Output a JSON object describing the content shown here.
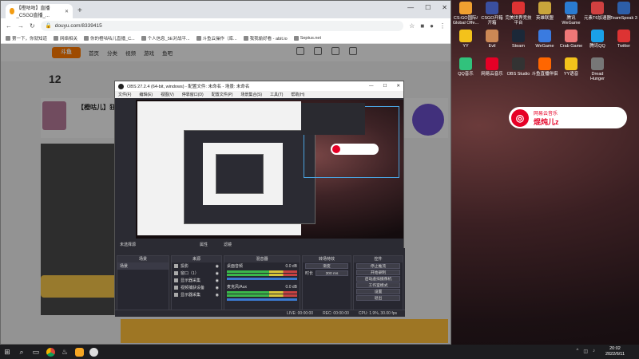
{
  "desktop": {
    "icons": [
      {
        "label": "CS:GO国际/ Global Offe...",
        "color": "#f0a030"
      },
      {
        "label": "CSGO开箱 开箱",
        "color": "#3a4fa0"
      },
      {
        "label": "完美世界竞技 平台",
        "color": "#d33"
      },
      {
        "label": "英雄联盟",
        "color": "#c9a53b"
      },
      {
        "label": "腾讯WeGame",
        "color": "#2a7bd1"
      },
      {
        "label": "元素T6加速器",
        "color": "#d04040"
      },
      {
        "label": "TeamSpeak 3",
        "color": "#2d5ea8"
      },
      {
        "label": "YY",
        "color": "#f3c21b"
      },
      {
        "label": "Evil",
        "color": "#c85"
      },
      {
        "label": "Steam",
        "color": "#1b2838"
      },
      {
        "label": "WeGame",
        "color": "#3a7be0"
      },
      {
        "label": "Crab Game",
        "color": "#e77"
      },
      {
        "label": "腾讯QQ",
        "color": "#1aa0e8"
      },
      {
        "label": "Twitter",
        "color": "#d33"
      },
      {
        "label": "QQ音乐",
        "color": "#31c27c"
      },
      {
        "label": "网易云音乐",
        "color": "#e60026"
      },
      {
        "label": "OBS Studio",
        "color": "#333"
      },
      {
        "label": "斗鱼直播伴侣",
        "color": "#f60"
      },
      {
        "label": "YY语音",
        "color": "#f3c21b"
      },
      {
        "label": "Dread Hunger",
        "color": "#777"
      }
    ]
  },
  "browser": {
    "tab_title": "【橙咕咕】直播_CSGO直播_...",
    "url": "douyu.com/8339415",
    "bookmarks": [
      "第一下，你就知道",
      "网络相关",
      "你的橙咕咕儿直播_C...",
      "个人信息_5E对战平...",
      "斗鱼云操作（库...",
      "我我偷好看 - abit.io",
      "Septus.net"
    ],
    "site_nav": [
      "首页",
      "分类",
      "视频",
      "游戏",
      "鱼吧"
    ],
    "room_title": "【橙咕儿】狂...",
    "room_level": "12"
  },
  "obs": {
    "title": "OBS 27.2.4 (64-bit, windows) - 配置文件: 未命名 - 场景: 未命名",
    "menu": [
      "文件(F)",
      "编辑(E)",
      "视图(V)",
      "停靠窗口(D)",
      "配置文件(P)",
      "场景集合(S)",
      "工具(T)",
      "帮助(H)"
    ],
    "docks": {
      "scenes": {
        "title": "场景",
        "items": [
          "场景"
        ]
      },
      "sources": {
        "title": "来源",
        "items": [
          "投影",
          "窗口（1）",
          "显示器采集",
          "视频捕获设备",
          "显示器采集"
        ]
      },
      "mixer": {
        "title": "混音器",
        "channels": [
          {
            "name": "桌面音频",
            "db": "0.0 dB"
          },
          {
            "name": "麦克风/Aux",
            "db": "0.0 dB"
          }
        ]
      },
      "transitions": {
        "title": "转场特效",
        "type": "渐变",
        "duration_label": "时长",
        "duration": "300 ms"
      },
      "controls": {
        "title": "控件",
        "buttons": [
          "停止推流",
          "开始录制",
          "启动虚拟摄像机",
          "工作室模式",
          "设置",
          "退出"
        ]
      }
    },
    "status": {
      "live": "LIVE: 00:00:00",
      "rec": "REC: 00:00:00",
      "cpu": "CPU: 1.9%, 30.00 fps"
    },
    "no_source_label": "未选择源",
    "props_label": "属性",
    "filters_label": "滤镜"
  },
  "music_widget": {
    "app": "网易云音乐",
    "user": "焜炖儿z"
  },
  "taskbar": {
    "time": "20:02",
    "date": "2022/6/11"
  }
}
